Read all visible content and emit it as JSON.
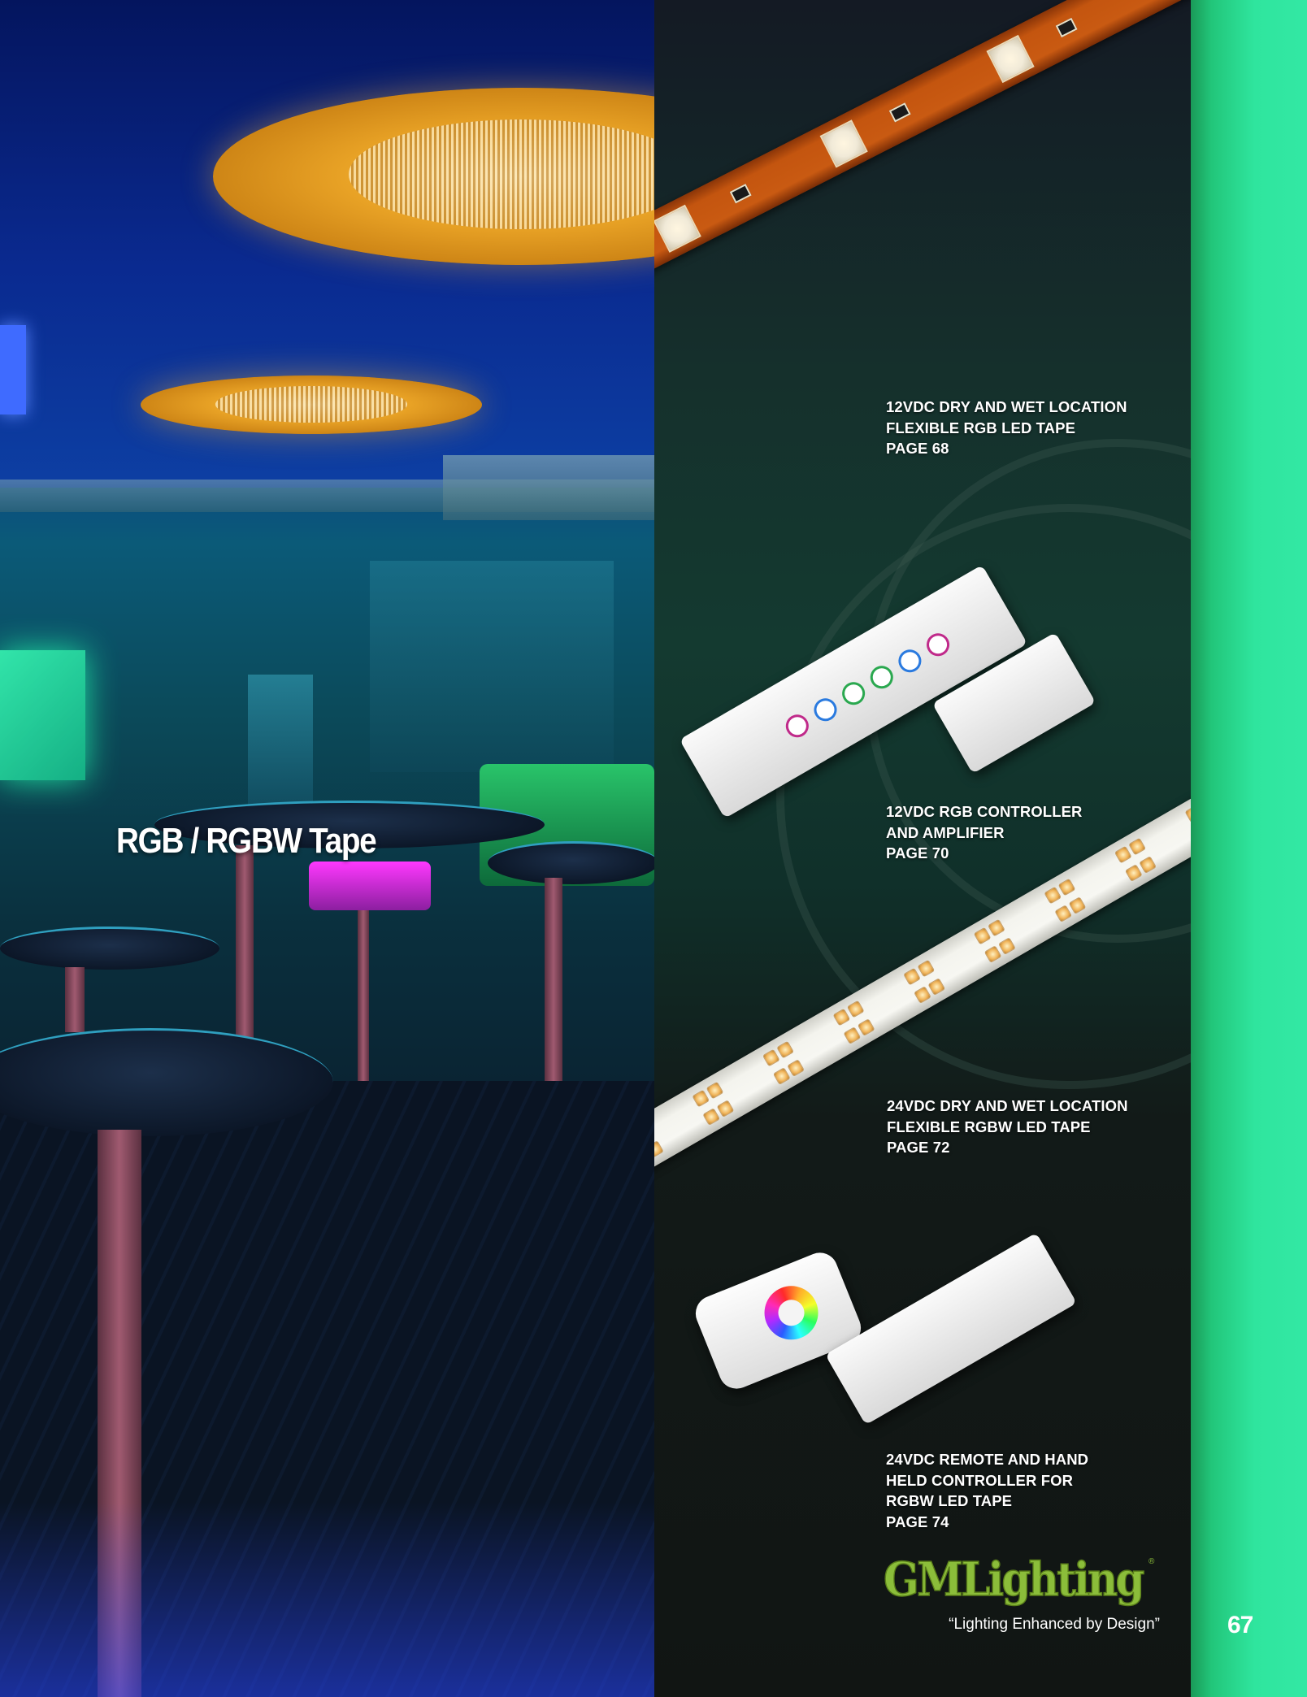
{
  "section": {
    "title": "RGB / RGBW Tape"
  },
  "products": [
    {
      "image": "rgb-led-tape",
      "lines": [
        "12VDC DRY AND WET LOCATION",
        "FLEXIBLE RGB LED TAPE",
        "PAGE 68"
      ]
    },
    {
      "image": "rgb-controller-amplifier",
      "lines": [
        "12VDC RGB CONTROLLER",
        "AND AMPLIFIER",
        "PAGE 70"
      ]
    },
    {
      "image": "rgbw-led-tape",
      "lines": [
        "24VDC DRY AND WET LOCATION",
        "FLEXIBLE RGBW LED TAPE",
        "PAGE 72"
      ]
    },
    {
      "image": "remote-hand-held-controller",
      "lines": [
        "24VDC REMOTE AND HAND",
        "HELD CONTROLLER FOR",
        "RGBW LED TAPE",
        "PAGE 74"
      ]
    }
  ],
  "brand": {
    "name": "GMLighting",
    "registered_mark": "®",
    "tagline": "“Lighting Enhanced by Design”"
  },
  "page_number": "67",
  "colors": {
    "accent_green": "#2fe59e",
    "logo_green": "#8bbd3a",
    "tape_orange": "#c95a12"
  }
}
